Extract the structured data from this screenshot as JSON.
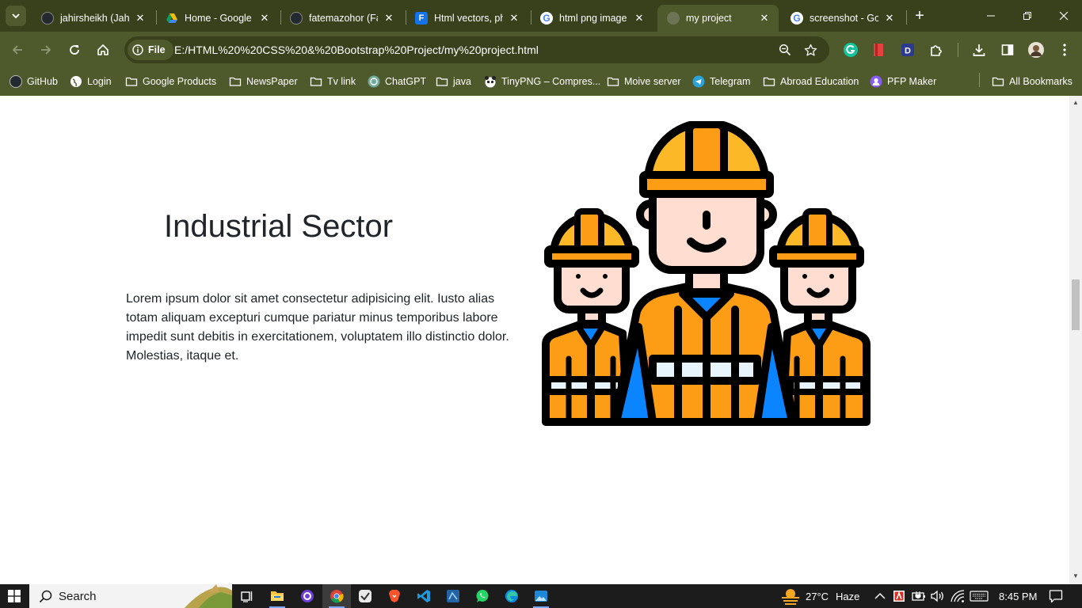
{
  "tabs": [
    {
      "title": "jahirsheikh (Jahir",
      "icon": "github-icon"
    },
    {
      "title": "Home - Google",
      "icon": "google-drive-icon"
    },
    {
      "title": "fatemazohor (Fa",
      "icon": "github-icon"
    },
    {
      "title": "Html vectors, ph",
      "icon": "freepik-icon"
    },
    {
      "title": "html png image",
      "icon": "google-icon"
    },
    {
      "title": "my project",
      "icon": "globe-icon"
    },
    {
      "title": "screenshot - Go",
      "icon": "google-icon"
    }
  ],
  "active_tab_index": 5,
  "address_bar": {
    "scheme_label": "File",
    "url": "E:/HTML%20%20CSS%20&%20Bootstrap%20Project/my%20project.html"
  },
  "bookmarks": [
    {
      "label": "GitHub",
      "icon": "github-icon"
    },
    {
      "label": "Login",
      "icon": "globe-icon"
    },
    {
      "label": "Google Products",
      "icon": "folder-icon"
    },
    {
      "label": "NewsPaper",
      "icon": "folder-icon"
    },
    {
      "label": "Tv link",
      "icon": "folder-icon"
    },
    {
      "label": "ChatGPT",
      "icon": "chatgpt-icon"
    },
    {
      "label": "java",
      "icon": "folder-icon"
    },
    {
      "label": "TinyPNG – Compres...",
      "icon": "panda-icon"
    },
    {
      "label": "Moive server",
      "icon": "folder-icon"
    },
    {
      "label": "Telegram",
      "icon": "telegram-icon"
    },
    {
      "label": "Abroad Education",
      "icon": "folder-icon"
    },
    {
      "label": "PFP Maker",
      "icon": "pfp-icon"
    }
  ],
  "all_bookmarks_label": "All Bookmarks",
  "page": {
    "heading": "Industrial Sector",
    "paragraph": "Lorem ipsum dolor sit amet consectetur adipisicing elit. Iusto alias totam aliquam excepturi cumque pariatur minus temporibus labore impedit sunt debitis in exercitationem, voluptatem illo distinctio dolor. Molestias, itaque et.",
    "image_subject": "three-construction-workers-illustration"
  },
  "taskbar": {
    "search_label": "Search",
    "weather_temp": "27°C",
    "weather_text": "Haze",
    "time": "8:45 PM"
  },
  "colors": {
    "tabstrip": "#38411c",
    "toolbar": "#4e5a2b",
    "helmet": "#fdb827",
    "vest": "#fd9d15",
    "shirt": "#0a84ff",
    "skin": "#ffddd0"
  }
}
